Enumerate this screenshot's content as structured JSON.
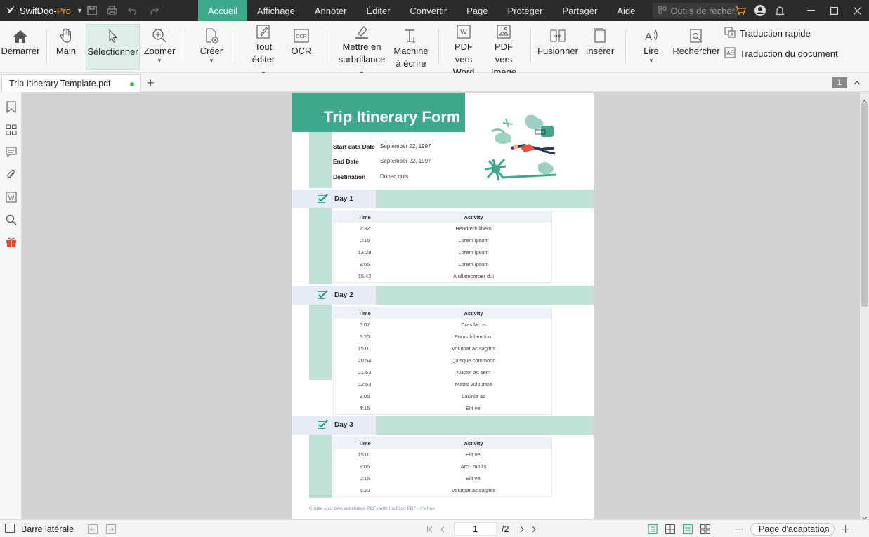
{
  "app": {
    "name_part1": "SwifDoo-",
    "name_part2": "Pro"
  },
  "menu": [
    "Accueil",
    "Affichage",
    "Annoter",
    "Éditer",
    "Convertir",
    "Page",
    "Protéger",
    "Partager",
    "Aide"
  ],
  "search": {
    "placeholder": "Outils de recher..."
  },
  "ribbon": {
    "start": "Démarrer",
    "hand": "Main",
    "select": "Sélectionner",
    "zoom": "Zoomer",
    "create": "Créer",
    "edit_all_1": "Tout",
    "edit_all_2": "éditer",
    "ocr": "OCR",
    "highlight_1": "Mettre en",
    "highlight_2": "surbrillance",
    "typewriter_1": "Machine",
    "typewriter_2": "à écrire",
    "pdf_word_1": "PDF vers",
    "pdf_word_2": "Word",
    "pdf_image_1": "PDF vers",
    "pdf_image_2": "Image",
    "merge": "Fusionner",
    "insert": "Insérer",
    "read": "Lire",
    "find": "Rechercher",
    "quick_translate": "Traduction rapide",
    "doc_translate": "Traduction du document"
  },
  "tab": {
    "title": "Trip Itinerary Template.pdf",
    "page_badge": "1"
  },
  "document": {
    "title": "Trip Itinerary Form",
    "info": [
      {
        "label": "Start data Date",
        "value": "September 22, 1997"
      },
      {
        "label": "End Date",
        "value": "September 22, 1997"
      },
      {
        "label": "Destination",
        "value": "Donec quis"
      }
    ],
    "days": [
      {
        "label": "Day 1",
        "head_time": "Time",
        "head_activity": "Activity",
        "rows": [
          [
            "7:32",
            "Hendrerit libero"
          ],
          [
            "0:16",
            "Lorem ipsum"
          ],
          [
            "13:29",
            "Lorem ipsum"
          ],
          [
            "9:05",
            "Lorem ipsum"
          ],
          [
            "15:42",
            "A ullamcorper dui"
          ]
        ]
      },
      {
        "label": "Day 2",
        "head_time": "Time",
        "head_activity": "Activity",
        "rows": [
          [
            "6:07",
            "Cras lacus"
          ],
          [
            "5:20",
            "Purus bibendum"
          ],
          [
            "15:01",
            "Volutpat ac sagittis"
          ],
          [
            "20:54",
            "Quisque commodo"
          ],
          [
            "21:53",
            "Auctor ac sem"
          ],
          [
            "22:53",
            "Mattis vulputate"
          ],
          [
            "9:05",
            "Lacinia ac"
          ],
          [
            "4:16",
            "Elit vel"
          ]
        ]
      },
      {
        "label": "Day 3",
        "head_time": "Time",
        "head_activity": "Activity",
        "rows": [
          [
            "15:01",
            "Elit vel"
          ],
          [
            "9:05",
            "Arcu mollis"
          ],
          [
            "0:16",
            "Elit vel"
          ],
          [
            "5:20",
            "Volutpat ac sagittis"
          ]
        ]
      }
    ],
    "footer": "Create your own automated PDFs with SwifDoo PDF - it's free"
  },
  "status": {
    "sidebar_label": "Barre latérale",
    "current_page": "1",
    "total_pages": "/2",
    "zoom_mode": "Page d'adaptation"
  },
  "colors": {
    "accent": "#3daa8b",
    "doc_teal": "#3fa88c",
    "doc_mint": "#bfe1d6",
    "titlebar": "#2b2b2b"
  }
}
